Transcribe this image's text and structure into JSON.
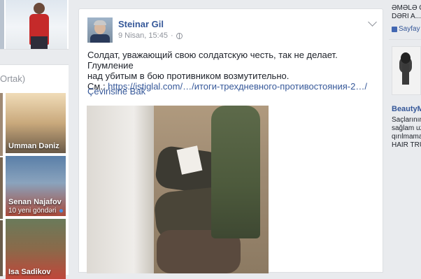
{
  "left": {
    "friends_heading": "Ortak)",
    "friends": [
      {
        "name": "Umman Dəniz",
        "sub": ""
      },
      {
        "name": "Senan Najafov",
        "sub": "10 yeni göndəri"
      },
      {
        "name": "Isa Sadikov",
        "sub": ""
      }
    ]
  },
  "post": {
    "author": "Steinar Gil",
    "date": "9 Nisan, 15:45",
    "separator": "·",
    "text_line1": "Солдат, уважающий свою солдатскую честь, так не делает. Глумление",
    "text_line2": "над убитым в бою противником возмутительно.",
    "text_prefix": "См.: ",
    "link_text": "https://istiglal.com/…/итоги-трехдневного-противостояния-2…/",
    "translate_label": "Çevirisine Bak"
  },
  "right": {
    "line1": "ƏMƏLƏ G",
    "line2": "DƏRI A...",
    "like_label": "Sayfay",
    "ad_title": "BeautyM",
    "ad_line1": "Saçlarının",
    "ad_line2": "sağlam uz",
    "ad_line3": "qırılmama",
    "ad_line4": "HAIR TRU"
  },
  "colors": {
    "link": "#365899",
    "background": "#e9ebee",
    "meta": "#90949c",
    "online": "#42b72a"
  },
  "icons": [
    "globe-icon",
    "chevron-down-icon",
    "thumbs-up-icon"
  ]
}
